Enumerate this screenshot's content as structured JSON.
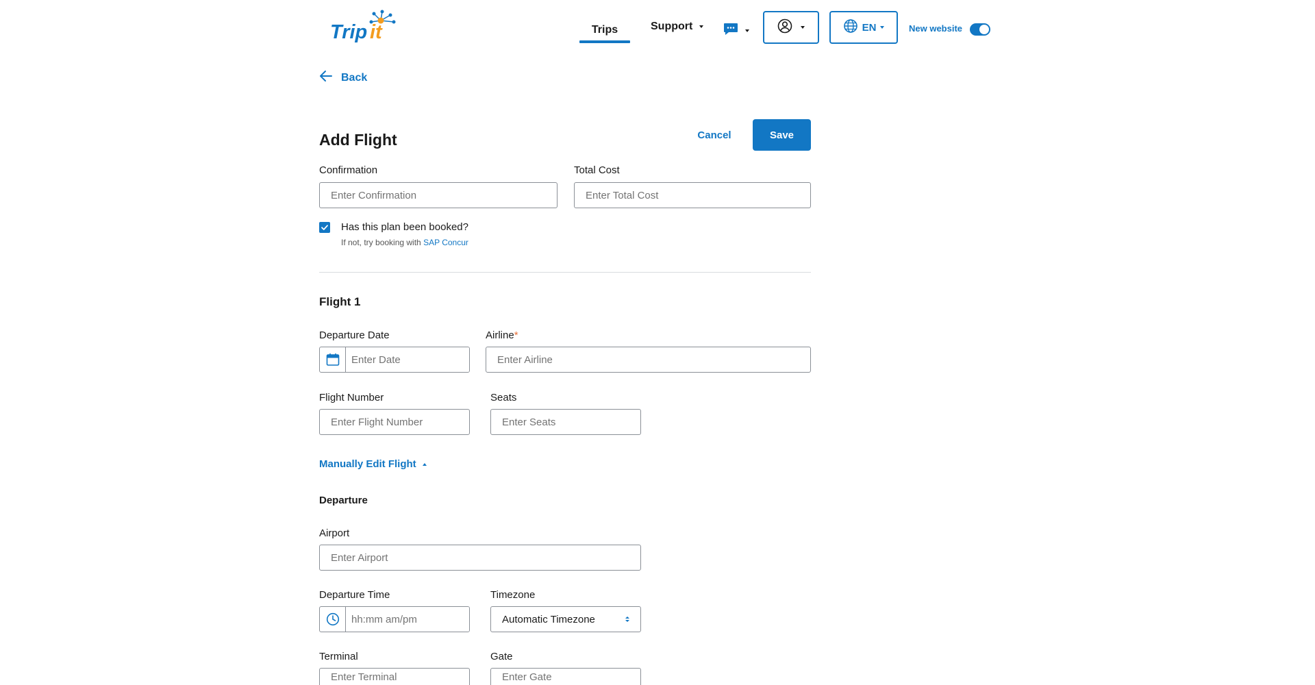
{
  "colors": {
    "accent": "#1277c4",
    "logo_orange": "#f39c1f",
    "required": "#e8713a"
  },
  "header": {
    "logo_text": "Tripit",
    "nav": {
      "trips": "Trips",
      "support": "Support"
    },
    "icons": {
      "chat": "chat-bubble-icon",
      "profile": "user-circle-icon",
      "language": "globe-icon"
    },
    "language": "EN",
    "new_website_label": "New website",
    "new_website_enabled": true
  },
  "back_label": "Back",
  "page": {
    "title": "Add Flight",
    "cancel_label": "Cancel",
    "save_label": "Save"
  },
  "form": {
    "confirmation": {
      "label": "Confirmation",
      "placeholder": "Enter Confirmation"
    },
    "total_cost": {
      "label": "Total Cost",
      "placeholder": "Enter Total Cost"
    },
    "booked": {
      "checked": true,
      "question": "Has this plan been booked?",
      "hint_prefix": "If not, try booking with ",
      "hint_link": "SAP Concur"
    },
    "flight": {
      "title": "Flight 1",
      "departure_date": {
        "label": "Departure Date",
        "placeholder": "Enter Date"
      },
      "airline": {
        "label": "Airline",
        "required_mark": "*",
        "placeholder": "Enter Airline"
      },
      "flight_number": {
        "label": "Flight Number",
        "placeholder": "Enter Flight Number"
      },
      "seats": {
        "label": "Seats",
        "placeholder": "Enter Seats"
      },
      "manual_edit_label": "Manually Edit Flight",
      "departure": {
        "title": "Departure",
        "airport": {
          "label": "Airport",
          "placeholder": "Enter Airport"
        },
        "time": {
          "label": "Departure Time",
          "placeholder": "hh:mm am/pm"
        },
        "timezone": {
          "label": "Timezone",
          "value": "Automatic Timezone"
        },
        "terminal": {
          "label": "Terminal",
          "placeholder": "Enter Terminal"
        },
        "gate": {
          "label": "Gate",
          "placeholder": "Enter Gate"
        }
      }
    }
  }
}
